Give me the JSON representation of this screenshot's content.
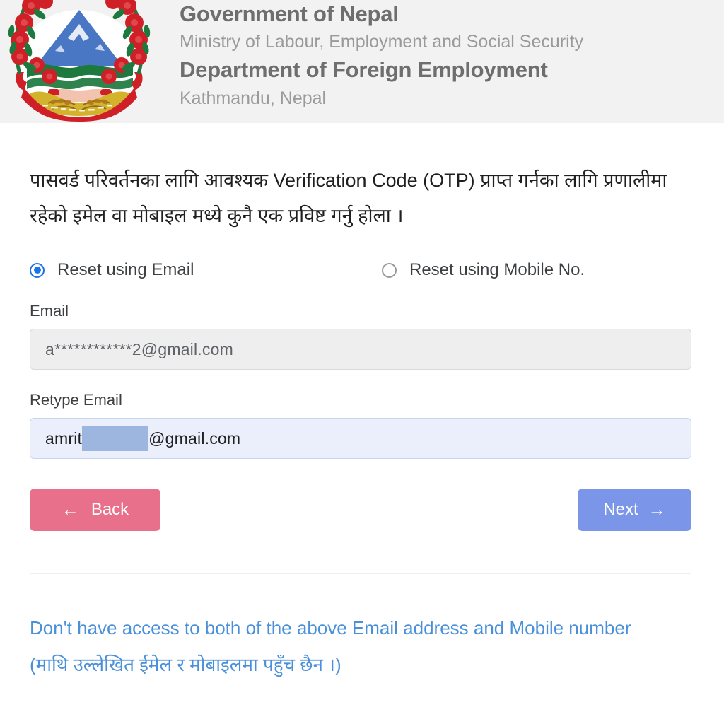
{
  "header": {
    "government": "Government of Nepal",
    "ministry": "Ministry of Labour, Employment and Social Security",
    "department": "Department of Foreign Employment",
    "city": "Kathmandu, Nepal",
    "emblem_icon": "nepal-emblem-icon",
    "background_color": "#f2f2f2"
  },
  "main": {
    "instruction": "पासवर्ड परिवर्तनका लागि आवश्यक Verification Code (OTP) प्राप्त गर्नका लागि प्रणालीमा रहेको इमेल वा मोबाइल मध्ये कुनै एक प्रविष्ट गर्नु होला ।",
    "reset_method": {
      "selected": "email",
      "options": [
        {
          "id": "email",
          "label": "Reset using Email",
          "checked": true
        },
        {
          "id": "mobile",
          "label": "Reset using Mobile No.",
          "checked": false
        }
      ]
    },
    "fields": [
      {
        "id": "email",
        "label": "Email",
        "value": "a************2@gmail.com",
        "placeholder": "Email",
        "state": "readonly"
      },
      {
        "id": "retype_email",
        "label": "Retype Email",
        "value_prefix": "amrit",
        "value_redacted": true,
        "value_suffix": "@gmail.com",
        "placeholder": "Retype Email",
        "state": "active"
      }
    ],
    "buttons": {
      "back": {
        "label": "Back",
        "icon": "arrow-left-icon",
        "glyph": "←",
        "color": "#e8708a"
      },
      "next": {
        "label": "Next",
        "icon": "arrow-right-icon",
        "glyph": "→",
        "color": "#7b96e8"
      }
    },
    "help_link": {
      "text": "Don't have access to both of the above Email address and Mobile number (माथि उल्लेखित ईमेल र मोबाइलमा पहुँच छैन ।)",
      "color": "#4a90d9"
    }
  }
}
